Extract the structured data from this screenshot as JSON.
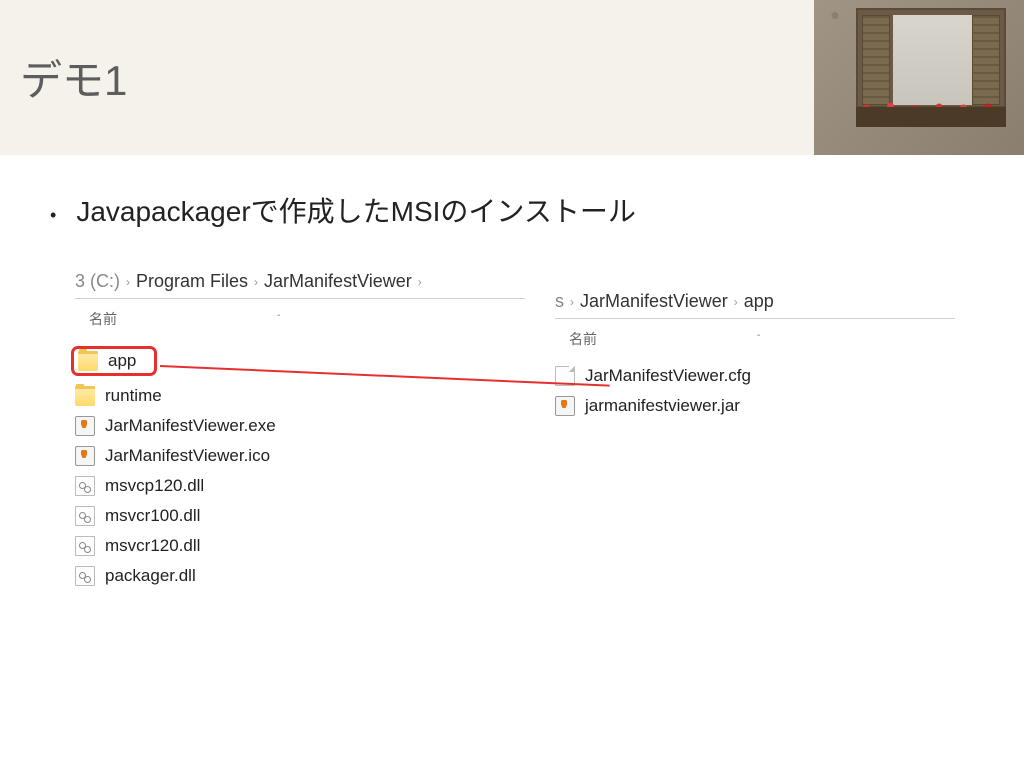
{
  "slide": {
    "title": "デモ1",
    "bullet_text": "Javapackagerで作成したMSIのインストール"
  },
  "explorer_left": {
    "breadcrumb": {
      "prefix": "3 (C:)",
      "seg1": "Program Files",
      "seg2": "JarManifestViewer"
    },
    "column_name": "名前",
    "items": [
      {
        "name": "app",
        "icon": "folder",
        "highlight": true
      },
      {
        "name": "runtime",
        "icon": "folder"
      },
      {
        "name": "JarManifestViewer.exe",
        "icon": "java"
      },
      {
        "name": "JarManifestViewer.ico",
        "icon": "java"
      },
      {
        "name": "msvcp120.dll",
        "icon": "dll"
      },
      {
        "name": "msvcr100.dll",
        "icon": "dll"
      },
      {
        "name": "msvcr120.dll",
        "icon": "dll"
      },
      {
        "name": "packager.dll",
        "icon": "dll"
      }
    ]
  },
  "explorer_right": {
    "breadcrumb": {
      "prefix": "s",
      "seg1": "JarManifestViewer",
      "seg2": "app"
    },
    "column_name": "名前",
    "items": [
      {
        "name": "JarManifestViewer.cfg",
        "icon": "page"
      },
      {
        "name": "jarmanifestviewer.jar",
        "icon": "java"
      }
    ]
  }
}
